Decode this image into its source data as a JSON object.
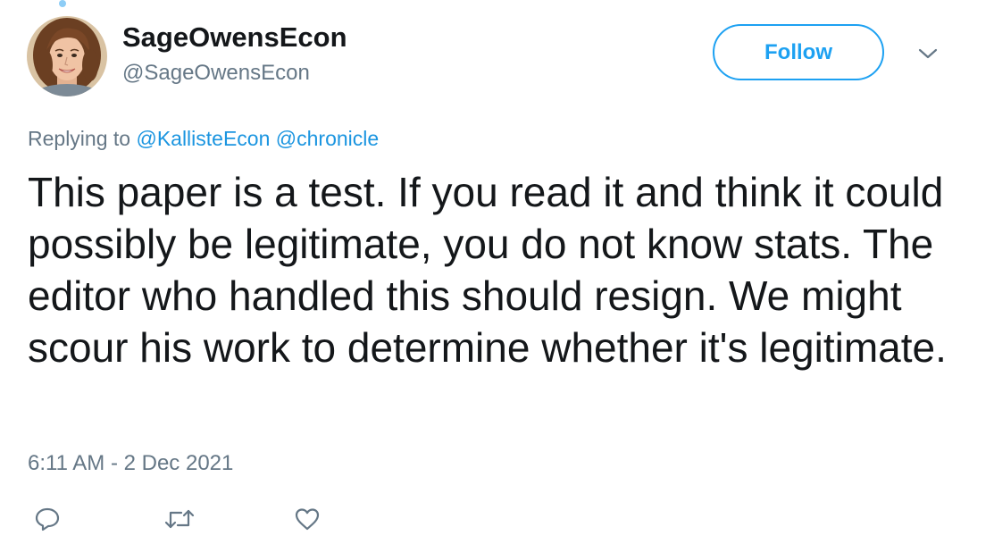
{
  "author": {
    "display_name": "SageOwensEcon",
    "handle": "@SageOwensEcon",
    "avatar_icon": "profile-photo"
  },
  "follow_button": {
    "label": "Follow",
    "color": "#1da1f2"
  },
  "menu": {
    "icon": "chevron-down-icon"
  },
  "reply": {
    "prefix": "Replying to",
    "mentions": [
      "@KallisteEcon",
      "@chronicle"
    ]
  },
  "tweet": {
    "text": "This paper is a test. If you read it and think it could possibly be legitimate, you do not know stats. The editor who handled this should resign. We might scour his work to determine whether it's legitimate.",
    "timestamp": "6:11 AM - 2 Dec 2021"
  },
  "actions": [
    {
      "icon": "reply-icon"
    },
    {
      "icon": "retweet-icon"
    },
    {
      "icon": "like-icon"
    }
  ],
  "colors": {
    "link": "#1b95e0",
    "secondary_text": "#657786",
    "primary_text": "#14171a"
  }
}
